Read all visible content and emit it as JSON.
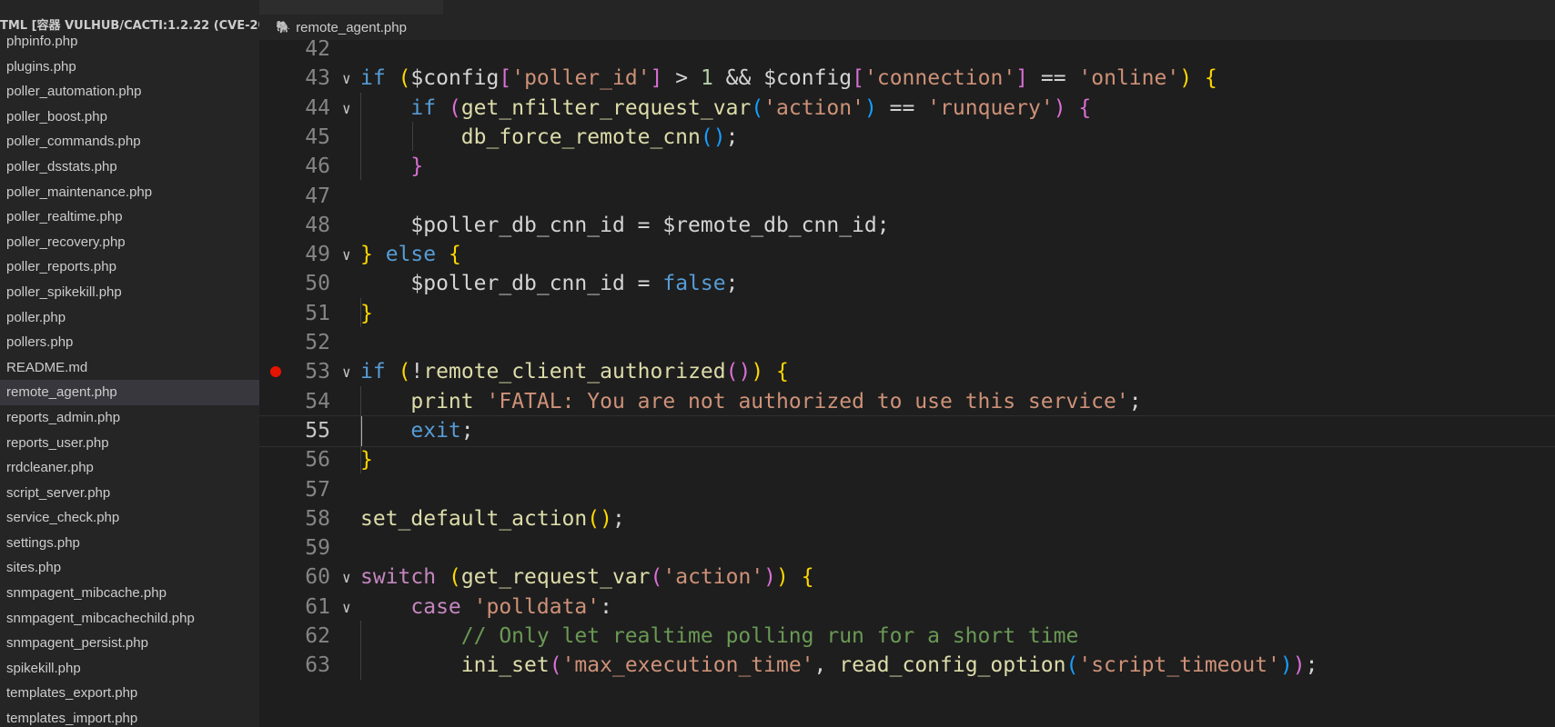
{
  "sidebar": {
    "title": "TML [容器 VULHUB/CACTI:1.2.22 (CVE-20...",
    "files": [
      "phpinfo.php",
      "plugins.php",
      "poller_automation.php",
      "poller_boost.php",
      "poller_commands.php",
      "poller_dsstats.php",
      "poller_maintenance.php",
      "poller_realtime.php",
      "poller_recovery.php",
      "poller_reports.php",
      "poller_spikekill.php",
      "poller.php",
      "pollers.php",
      "README.md",
      "remote_agent.php",
      "reports_admin.php",
      "reports_user.php",
      "rrdcleaner.php",
      "script_server.php",
      "service_check.php",
      "settings.php",
      "sites.php",
      "snmpagent_mibcache.php",
      "snmpagent_mibcachechild.php",
      "snmpagent_persist.php",
      "spikekill.php",
      "templates_export.php",
      "templates_import.php"
    ],
    "active_file": "remote_agent.php"
  },
  "tab": {
    "icon": "php-elephant-icon",
    "label": "remote_agent.php"
  },
  "editor": {
    "current_line": 55,
    "breakpoint_line": 53,
    "lines": [
      {
        "n": "42",
        "fold": false,
        "tokens": []
      },
      {
        "n": "43",
        "fold": true,
        "tokens": [
          [
            "kw",
            "if"
          ],
          [
            "var",
            " "
          ],
          [
            "b1",
            "("
          ],
          [
            "var",
            "$config"
          ],
          [
            "b2",
            "["
          ],
          [
            "str",
            "'poller_id'"
          ],
          [
            "b2",
            "]"
          ],
          [
            "var",
            " > "
          ],
          [
            "num",
            "1"
          ],
          [
            "var",
            " && $config"
          ],
          [
            "b2",
            "["
          ],
          [
            "str",
            "'connection'"
          ],
          [
            "b2",
            "]"
          ],
          [
            "var",
            " == "
          ],
          [
            "str",
            "'online'"
          ],
          [
            "b1",
            ")"
          ],
          [
            "var",
            " "
          ],
          [
            "b1",
            "{"
          ]
        ]
      },
      {
        "n": "44",
        "fold": true,
        "tokens": [
          [
            "var",
            "    "
          ],
          [
            "kw",
            "if"
          ],
          [
            "var",
            " "
          ],
          [
            "b2",
            "("
          ],
          [
            "fn",
            "get_nfilter_request_var"
          ],
          [
            "b3",
            "("
          ],
          [
            "str",
            "'action'"
          ],
          [
            "b3",
            ")"
          ],
          [
            "var",
            " == "
          ],
          [
            "str",
            "'runquery'"
          ],
          [
            "b2",
            ")"
          ],
          [
            "var",
            " "
          ],
          [
            "b2",
            "{"
          ]
        ]
      },
      {
        "n": "45",
        "fold": false,
        "tokens": [
          [
            "var",
            "        "
          ],
          [
            "fn",
            "db_force_remote_cnn"
          ],
          [
            "b3",
            "()"
          ],
          [
            "var",
            ";"
          ]
        ]
      },
      {
        "n": "46",
        "fold": false,
        "tokens": [
          [
            "var",
            "    "
          ],
          [
            "b2",
            "}"
          ]
        ]
      },
      {
        "n": "47",
        "fold": false,
        "tokens": []
      },
      {
        "n": "48",
        "fold": false,
        "tokens": [
          [
            "var",
            "    $poller_db_cnn_id = $remote_db_cnn_id;"
          ]
        ]
      },
      {
        "n": "49",
        "fold": true,
        "tokens": [
          [
            "b1",
            "}"
          ],
          [
            "var",
            " "
          ],
          [
            "kw",
            "else"
          ],
          [
            "var",
            " "
          ],
          [
            "b1",
            "{"
          ]
        ]
      },
      {
        "n": "50",
        "fold": false,
        "tokens": [
          [
            "var",
            "    $poller_db_cnn_id = "
          ],
          [
            "kw",
            "false"
          ],
          [
            "var",
            ";"
          ]
        ]
      },
      {
        "n": "51",
        "fold": false,
        "tokens": [
          [
            "b1",
            "}"
          ]
        ]
      },
      {
        "n": "52",
        "fold": false,
        "tokens": []
      },
      {
        "n": "53",
        "fold": true,
        "tokens": [
          [
            "kw",
            "if"
          ],
          [
            "var",
            " "
          ],
          [
            "b1",
            "("
          ],
          [
            "var",
            "!"
          ],
          [
            "fn",
            "remote_client_authorized"
          ],
          [
            "b2",
            "()"
          ],
          [
            "b1",
            ")"
          ],
          [
            "var",
            " "
          ],
          [
            "b1",
            "{"
          ]
        ]
      },
      {
        "n": "54",
        "fold": false,
        "tokens": [
          [
            "var",
            "    "
          ],
          [
            "fn",
            "print"
          ],
          [
            "var",
            " "
          ],
          [
            "str",
            "'FATAL: You are not authorized to use this service'"
          ],
          [
            "var",
            ";"
          ]
        ]
      },
      {
        "n": "55",
        "fold": false,
        "tokens": [
          [
            "var",
            "    "
          ],
          [
            "kw",
            "exit"
          ],
          [
            "var",
            ";"
          ]
        ]
      },
      {
        "n": "56",
        "fold": false,
        "tokens": [
          [
            "b1",
            "}"
          ]
        ]
      },
      {
        "n": "57",
        "fold": false,
        "tokens": []
      },
      {
        "n": "58",
        "fold": false,
        "tokens": [
          [
            "fn",
            "set_default_action"
          ],
          [
            "b1",
            "()"
          ],
          [
            "var",
            ";"
          ]
        ]
      },
      {
        "n": "59",
        "fold": false,
        "tokens": []
      },
      {
        "n": "60",
        "fold": true,
        "tokens": [
          [
            "ctl",
            "switch"
          ],
          [
            "var",
            " "
          ],
          [
            "b1",
            "("
          ],
          [
            "fn",
            "get_request_var"
          ],
          [
            "b2",
            "("
          ],
          [
            "str",
            "'action'"
          ],
          [
            "b2",
            ")"
          ],
          [
            "b1",
            ")"
          ],
          [
            "var",
            " "
          ],
          [
            "b1",
            "{"
          ]
        ]
      },
      {
        "n": "61",
        "fold": true,
        "tokens": [
          [
            "var",
            "    "
          ],
          [
            "ctl",
            "case"
          ],
          [
            "var",
            " "
          ],
          [
            "str",
            "'polldata'"
          ],
          [
            "var",
            ":"
          ]
        ]
      },
      {
        "n": "62",
        "fold": false,
        "tokens": [
          [
            "var",
            "        "
          ],
          [
            "cmt",
            "// Only let realtime polling run for a short time"
          ]
        ]
      },
      {
        "n": "63",
        "fold": false,
        "tokens": [
          [
            "var",
            "        "
          ],
          [
            "fn",
            "ini_set"
          ],
          [
            "b2",
            "("
          ],
          [
            "str",
            "'max_execution_time'"
          ],
          [
            "var",
            ", "
          ],
          [
            "fn",
            "read_config_option"
          ],
          [
            "b3",
            "("
          ],
          [
            "str",
            "'script_timeout'"
          ],
          [
            "b3",
            ")"
          ],
          [
            "b2",
            ")"
          ],
          [
            "var",
            ";"
          ]
        ]
      }
    ]
  }
}
